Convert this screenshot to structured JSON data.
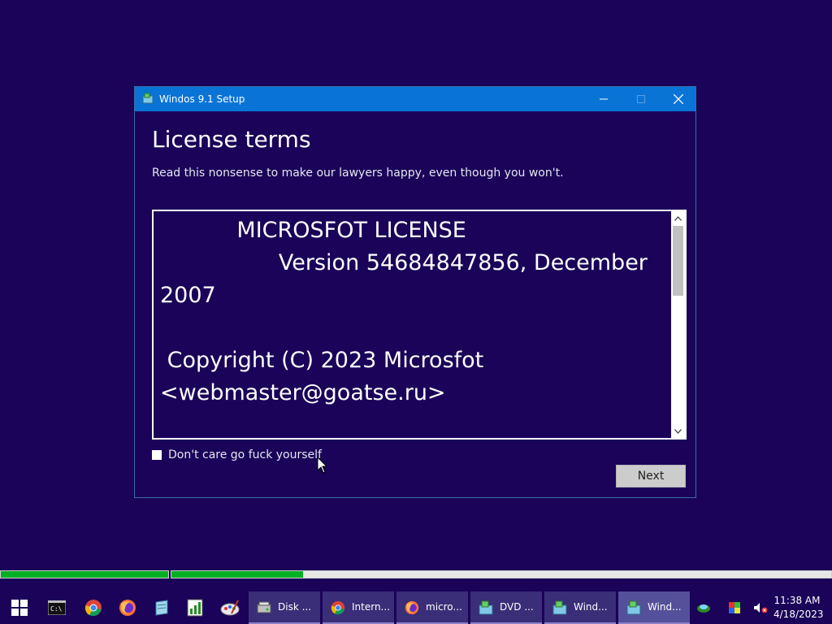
{
  "window": {
    "title": "Windos 9.1 Setup",
    "heading": "License terms",
    "subtitle": "Read this nonsense to make our lawyers happy, even though you won't.",
    "license_text": "           MICROSFOT LICENSE\n                 Version 54684847856, December\n2007\n\n Copyright (C) 2023 Microsfot\n<webmaster@goatse.ru>",
    "agree_label": "Don't care go fuck yourself",
    "agree_checked": false,
    "next_label": "Next"
  },
  "progress": [
    {
      "fill": 1.0
    },
    {
      "fill": 0.2
    }
  ],
  "taskbar": {
    "pinned": [
      "windows-start-icon",
      "command-prompt-icon",
      "chrome-icon",
      "firefox-icon",
      "notepad-icon",
      "spreadsheet-icon",
      "paint-icon"
    ],
    "tasks": [
      {
        "label": "Disk ...",
        "icon": "disk-icon",
        "active": false
      },
      {
        "label": "Intern...",
        "icon": "chrome-icon",
        "active": false
      },
      {
        "label": "micro...",
        "icon": "firefox-icon",
        "active": false
      },
      {
        "label": "DVD ...",
        "icon": "setup-icon",
        "active": false
      },
      {
        "label": "Wind...",
        "icon": "setup-icon",
        "active": false
      },
      {
        "label": "Wind...",
        "icon": "setup-icon",
        "active": true
      }
    ],
    "time": "11:38 AM",
    "date": "4/18/2023"
  },
  "colors": {
    "desktop": "#1a0358",
    "titlebar": "#0a74d6",
    "progress_green": "#06b025"
  }
}
